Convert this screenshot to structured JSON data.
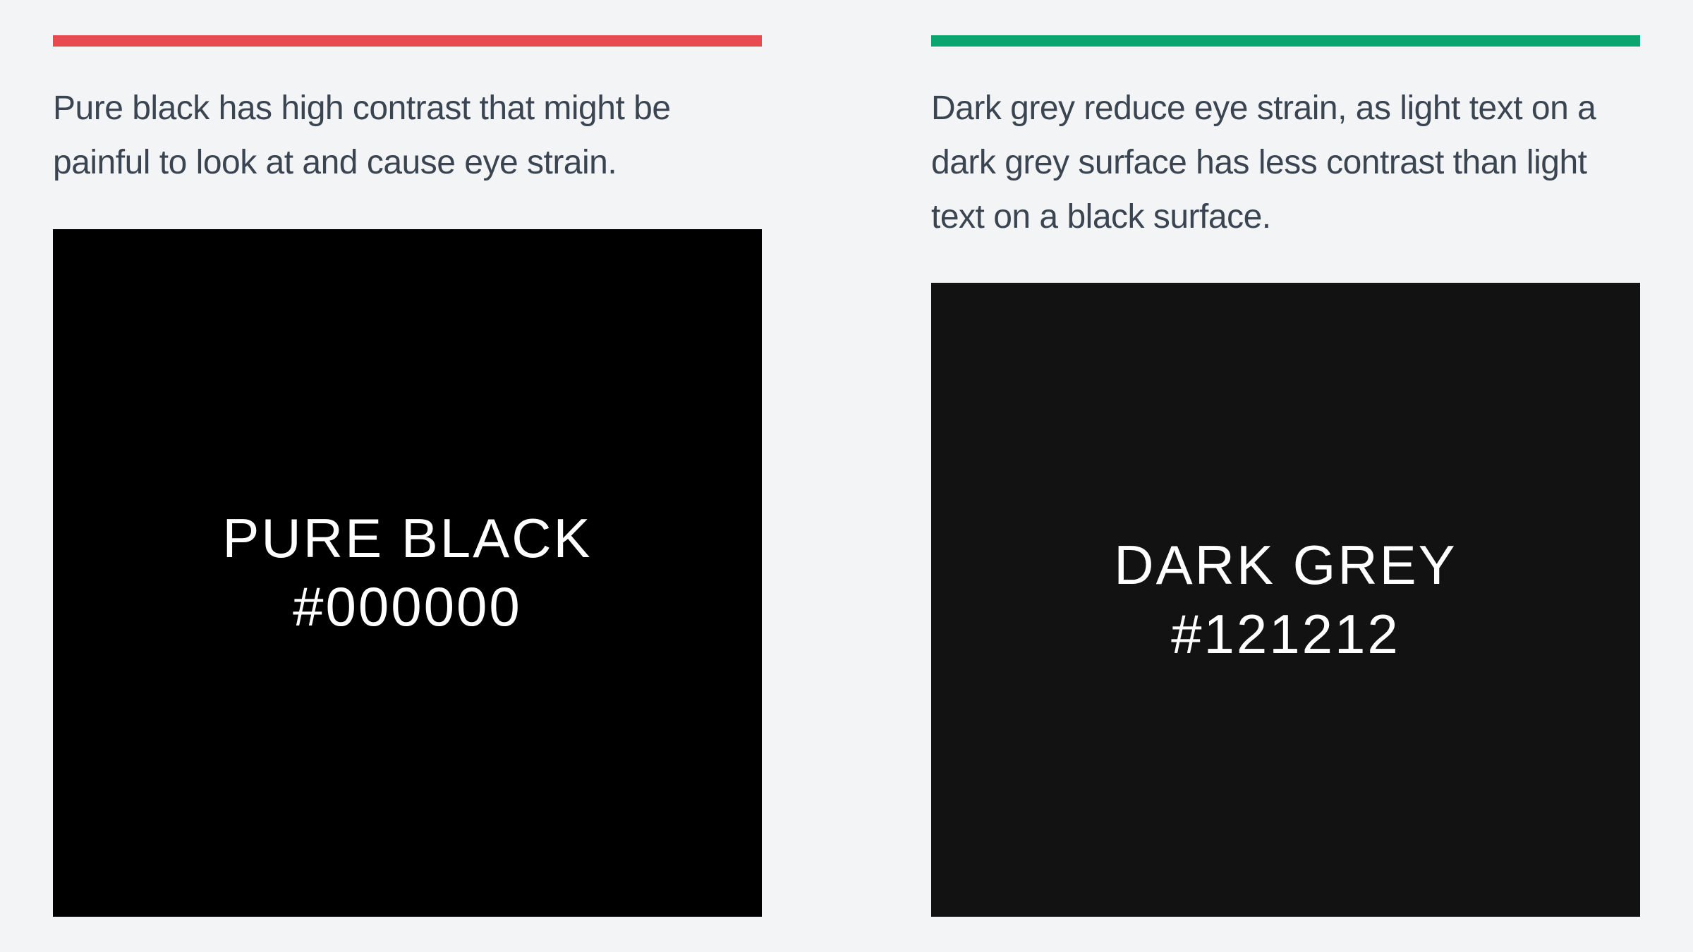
{
  "columns": [
    {
      "accent_color": "#e84a4d",
      "description": "Pure black has high contrast that might be painful to look at and cause eye strain.",
      "swatch": {
        "bg": "#000000",
        "label": "PURE BLACK",
        "hex": "#000000"
      }
    },
    {
      "accent_color": "#0da56f",
      "description": "Dark grey reduce eye strain, as light text on a dark grey surface has less contrast than light text on a black surface.",
      "swatch": {
        "bg": "#121212",
        "label": "DARK GREY",
        "hex": "#121212"
      }
    }
  ]
}
